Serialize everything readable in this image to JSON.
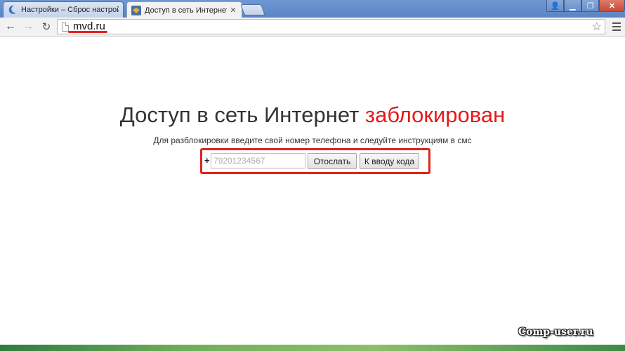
{
  "tabs": [
    {
      "label": "Настройки – Сброс настрой",
      "active": false,
      "icon": "settings-icon"
    },
    {
      "label": "Доступ в сеть Интернет за",
      "active": true,
      "icon": "mvd-emblem-icon"
    }
  ],
  "window_controls": {
    "user": "user-icon",
    "minimize": "minimize-icon",
    "maximize": "maximize-icon",
    "close": "close-icon"
  },
  "toolbar": {
    "url": "mvd.ru",
    "back": "back-arrow-icon",
    "forward": "forward-arrow-icon",
    "reload": "reload-icon",
    "bookmark": "star-icon",
    "menu": "menu-icon"
  },
  "page": {
    "headline_main": "Доступ в сеть Интернет ",
    "headline_red": "заблокирован",
    "subline": "Для разблокировки введите свой номер телефона и следуйте инструкциям в смс",
    "phone_prefix": "+",
    "phone_placeholder": "79201234567",
    "send_button": "Отослать",
    "code_button": "К вводу кода"
  },
  "watermark": "Comp-user.ru",
  "colors": {
    "accent_red": "#e81818",
    "highlight_red": "#e2231a",
    "titlebar": "#5a84c6"
  }
}
